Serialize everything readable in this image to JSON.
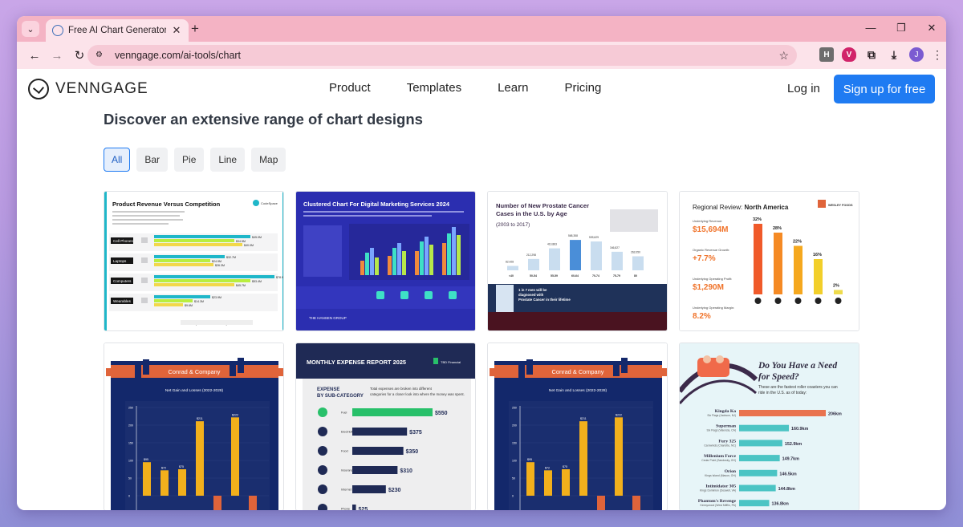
{
  "browser": {
    "tab_title": "Free AI Chart Generator - Make",
    "url": "venngage.com/ai-tools/chart",
    "profile_initial": "J",
    "ext_h": "H"
  },
  "header": {
    "logo": "VENNGAGE",
    "nav": [
      "Product",
      "Templates",
      "Learn",
      "Pricing"
    ],
    "login": "Log in",
    "signup": "Sign up for free"
  },
  "section": {
    "title": "Discover an extensive range of chart designs",
    "filters": [
      "All",
      "Bar",
      "Pie",
      "Line",
      "Map"
    ],
    "active_filter": "All"
  },
  "cards": {
    "product_revenue": {
      "title": "Product Revenue Versus Competition",
      "brand": "CodeSpace",
      "rows": [
        "Cell Phones",
        "Laptops",
        "Computers",
        "Wearables"
      ],
      "values": [
        [
          "$45.0M",
          "$34.5M",
          "$40.0M"
        ],
        [
          "$32.7M",
          "$24.9M",
          "$26.3M"
        ],
        [
          "$78.9M",
          "$53.4M",
          "$45.7M"
        ],
        [
          "$23.9M",
          "$14.3M",
          "$9.6M"
        ]
      ],
      "legend": [
        "CodeSpace",
        "Hexa",
        "Orby",
        "Soft"
      ]
    },
    "clustered": {
      "title": "Clustered Chart For Digital Marketing Services 2024",
      "footer": "THE HANSEN GROUP"
    },
    "prostate": {
      "title": "Number of New Prostate Cancer Cases in the U.S. by Age",
      "subtitle": "(2003 to 2017)",
      "values": [
        "82,428",
        "212,298",
        "410,883",
        "568,358",
        "539,629",
        "346,827",
        "262,050"
      ],
      "ages": [
        "<40",
        "50-54",
        "55-59",
        "60-64",
        "70-74",
        "75-79",
        "80"
      ],
      "callout": "1 in 7 men will be diagnosed with Prostate Cancer in their lifetime"
    },
    "regional": {
      "title_prefix": "Regional Review: ",
      "title_bold": "North America",
      "brand": "WESLEY FOODS",
      "kpis": [
        {
          "label": "Underlying Revenue:",
          "value": "$15,694M"
        },
        {
          "label": "Organic Revenue Growth:",
          "value": "+7.7%"
        },
        {
          "label": "Underlying Operating Profit:",
          "value": "$1,290M"
        },
        {
          "label": "Underlying Operating Margin:",
          "value": "8.2%"
        }
      ],
      "bars": [
        "32%",
        "28%",
        "22%",
        "16%",
        "2%"
      ]
    },
    "conrad1": {
      "brand": "Conrad & Company",
      "chart_title": "Net Gain and Losses (2022-2028)",
      "labels": [
        "$95",
        "$72",
        "$75",
        "$211",
        "$222"
      ]
    },
    "monthly": {
      "title": "MONTHLY EXPENSE REPORT 2025",
      "brand": "TBD Financial",
      "sub": "EXPENSE BY SUB-CATEGORY",
      "desc": "Total expenses are broken into different categories for a closer look into where the money was spent.",
      "items": [
        {
          "name": "Fuel",
          "value": "$550"
        },
        {
          "name": "Electricity",
          "value": "$375"
        },
        {
          "name": "Food",
          "value": "$350"
        },
        {
          "name": "Insurance",
          "value": "$310"
        },
        {
          "name": "Internet",
          "value": "$230"
        },
        {
          "name": "Phone",
          "value": "$25"
        }
      ]
    },
    "conrad2": {
      "brand": "Conrad & Company",
      "chart_title": "Net Gain and Losses (2022-2028)",
      "labels": [
        "$95",
        "$72",
        "$75",
        "$211",
        "$222"
      ]
    },
    "speed": {
      "title": "Do You Have a Need for Speed?",
      "subtitle": "These are the fastest roller coasters you can ride in the U.S. as of today:",
      "items": [
        {
          "name": "Kingda Ka",
          "place": "Six Flags (Jackson, NJ)",
          "value": "206km"
        },
        {
          "name": "Superman",
          "place": "Six Flags (Valencia, CA)",
          "value": "160.9km"
        },
        {
          "name": "Fury 325",
          "place": "Carowinds (Charlotte, NC)",
          "value": "152.9km"
        },
        {
          "name": "Millenium Force",
          "place": "Cedar Point (Sandusky, OH)",
          "value": "149.7km"
        },
        {
          "name": "Orion",
          "place": "Kings Island (Mason, OH)",
          "value": "146.5km"
        },
        {
          "name": "Intimidator 305",
          "place": "Kings Dominion (Doswell, VA)",
          "value": "144.8km"
        },
        {
          "name": "Phantom's Revenge",
          "place": "Kennywood (West Mifflin, PA)",
          "value": "136.8km"
        }
      ]
    }
  },
  "colors": {
    "tab_strip": "#f4b3c4",
    "toolbar": "#fce3ea",
    "accent": "#1f7bf2",
    "navy": "#13286b",
    "conrad_orange": "#e0643a",
    "conrad_bar": "#f2b01c"
  }
}
